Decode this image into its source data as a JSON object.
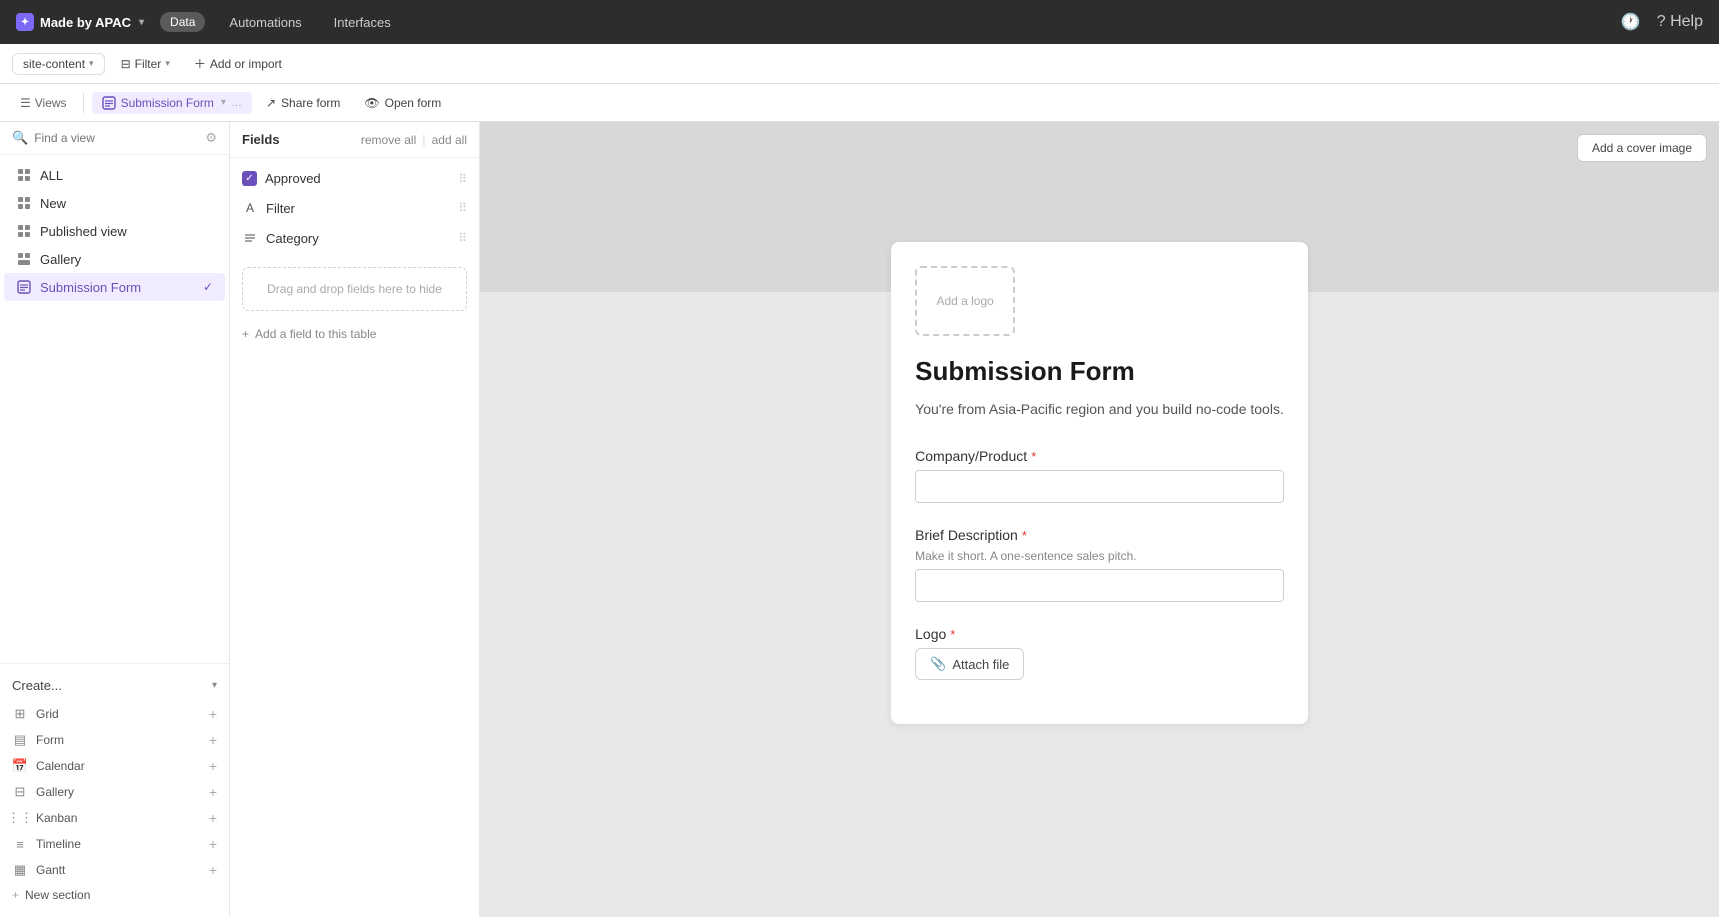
{
  "topNav": {
    "logo_label": "Made by APAC",
    "chevron": "▾",
    "pills": [
      {
        "label": "Data",
        "active": true
      },
      {
        "label": "Automations",
        "active": false
      },
      {
        "label": "Interfaces",
        "active": false
      }
    ],
    "right_icons": [
      "🕐",
      "? Help"
    ]
  },
  "toolbar": {
    "site_content_label": "site-content",
    "filter_label": "Filter",
    "add_import_label": "Add or import"
  },
  "viewsBar": {
    "views_label": "Views",
    "tabs": [
      {
        "label": "Submission Form",
        "active": true,
        "icon": "form"
      },
      {
        "label": "Share form",
        "active": false
      },
      {
        "label": "Open form",
        "active": false
      }
    ]
  },
  "sidebar": {
    "search_placeholder": "Find a view",
    "nav_items": [
      {
        "label": "ALL",
        "icon": "grid"
      },
      {
        "label": "New",
        "icon": "grid"
      },
      {
        "label": "Published view",
        "icon": "grid"
      },
      {
        "label": "Gallery",
        "icon": "gallery"
      },
      {
        "label": "Submission Form",
        "icon": "form",
        "active": true
      }
    ],
    "create_label": "Create...",
    "create_items": [
      {
        "label": "Grid"
      },
      {
        "label": "Form"
      },
      {
        "label": "Calendar"
      },
      {
        "label": "Gallery"
      },
      {
        "label": "Kanban"
      },
      {
        "label": "Timeline"
      },
      {
        "label": "Gantt"
      }
    ],
    "new_section_label": "New section"
  },
  "fields": {
    "title": "Fields",
    "remove_all": "remove all",
    "add_all": "add all",
    "items": [
      {
        "label": "Approved",
        "type": "checkbox",
        "checked": true
      },
      {
        "label": "Filter",
        "type": "text"
      },
      {
        "label": "Category",
        "type": "list"
      }
    ],
    "drop_zone_hint": "Drag and drop fields here to hide",
    "add_field_label": "Add a field to this table"
  },
  "form": {
    "add_cover_label": "Add a cover image",
    "add_logo_label": "Add a logo",
    "title": "Submission Form",
    "description": "You're from Asia-Pacific region and you build no-code tools.",
    "fields": [
      {
        "label": "Company/Product",
        "required": true,
        "type": "text",
        "hint": ""
      },
      {
        "label": "Brief Description",
        "required": true,
        "type": "text",
        "hint": "Make it short. A one-sentence sales pitch."
      },
      {
        "label": "Logo",
        "required": true,
        "type": "file",
        "attach_label": "Attach file"
      }
    ]
  }
}
